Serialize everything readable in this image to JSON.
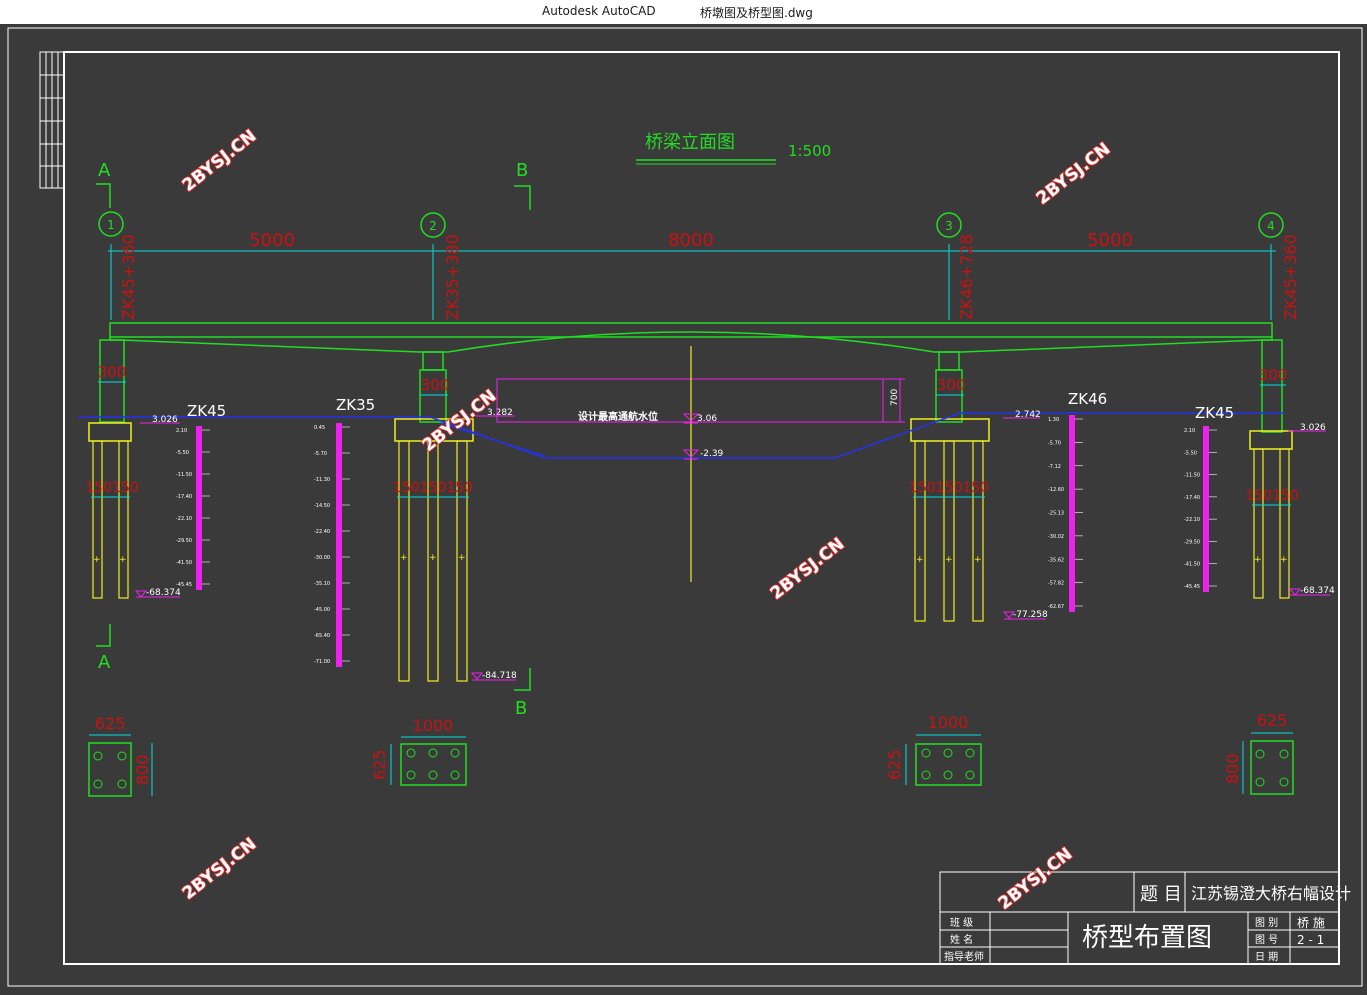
{
  "window": {
    "app_name": "Autodesk AutoCAD",
    "document_name": "桥墩图及桥型图.dwg"
  },
  "colors": {
    "background": "#3a3a3a",
    "frame": "#ffffff",
    "green": "#22dd22",
    "cyan": "#00dddd",
    "red": "#cc1111",
    "yellow": "#eeee22",
    "magenta": "#ee22ee",
    "blue": "#2233ee",
    "watermark": "#ff3333"
  },
  "drawing": {
    "title": "桥梁立面图",
    "scale": "1:500",
    "watermark": "2BYSJ.CN",
    "section_a": "A",
    "section_b": "B",
    "spans": [
      "5000",
      "8000",
      "5000"
    ],
    "stations": [
      "ZK45+360",
      "ZK35+380",
      "ZK46+728",
      "ZK45+360"
    ],
    "axis_numbers": [
      "1",
      "2",
      "3",
      "4"
    ],
    "boreholes": [
      "ZK45",
      "ZK35",
      "ZK46",
      "ZK45"
    ],
    "pier_width_labels": [
      "300",
      "300",
      "300",
      "300"
    ],
    "pile_spacing_labels": [
      "150150",
      "150150150",
      "150150150",
      "150150"
    ],
    "ground_levels": [
      "3.026",
      "3.282",
      "2.742",
      "3.026"
    ],
    "pile_tip_levels": [
      "-68.374",
      "-84.718",
      "-77.258",
      "-68.374"
    ],
    "navigation_water_level_label": "设计最高通航水位",
    "navigation_clearance": "700",
    "water_level": "3.06",
    "river_bottom_level": "-2.39",
    "cap_plan_widths": [
      "625",
      "1000",
      "1000",
      "625"
    ],
    "cap_plan_depths": [
      "800",
      "625",
      "625",
      "800"
    ],
    "borehole_depths": [
      [
        "2.10",
        "-5.50",
        "-11.50",
        "-17.40",
        "-22.10",
        "-29.50",
        "-41.50",
        "-45.45"
      ],
      [
        "0.45",
        "-5.70",
        "-11.30",
        "-14.50",
        "-22.40",
        "-30.00",
        "-35.10",
        "-45.00",
        "-65.40",
        "-71.00"
      ],
      [
        "1.30",
        "-5.70",
        "-7.12",
        "-12.60",
        "-25.13",
        "-30.02",
        "-35.62",
        "-57.82",
        "-62.67"
      ],
      [
        "2.10",
        "-5.50",
        "-11.50",
        "-17.40",
        "-22.10",
        "-29.50",
        "-41.50",
        "-45.45"
      ]
    ]
  },
  "title_block": {
    "subject_label": "题 目",
    "subject": "江苏锡澄大桥右幅设计",
    "drawing_name": "桥型布置图",
    "class_label": "班 级",
    "name_label": "姓 名",
    "advisor_label": "指导老师",
    "sheet_label": "图 别",
    "sheet_value": "桥 施",
    "number_label": "图 号",
    "number_value": "2 - 1",
    "date_label": "日 期"
  }
}
